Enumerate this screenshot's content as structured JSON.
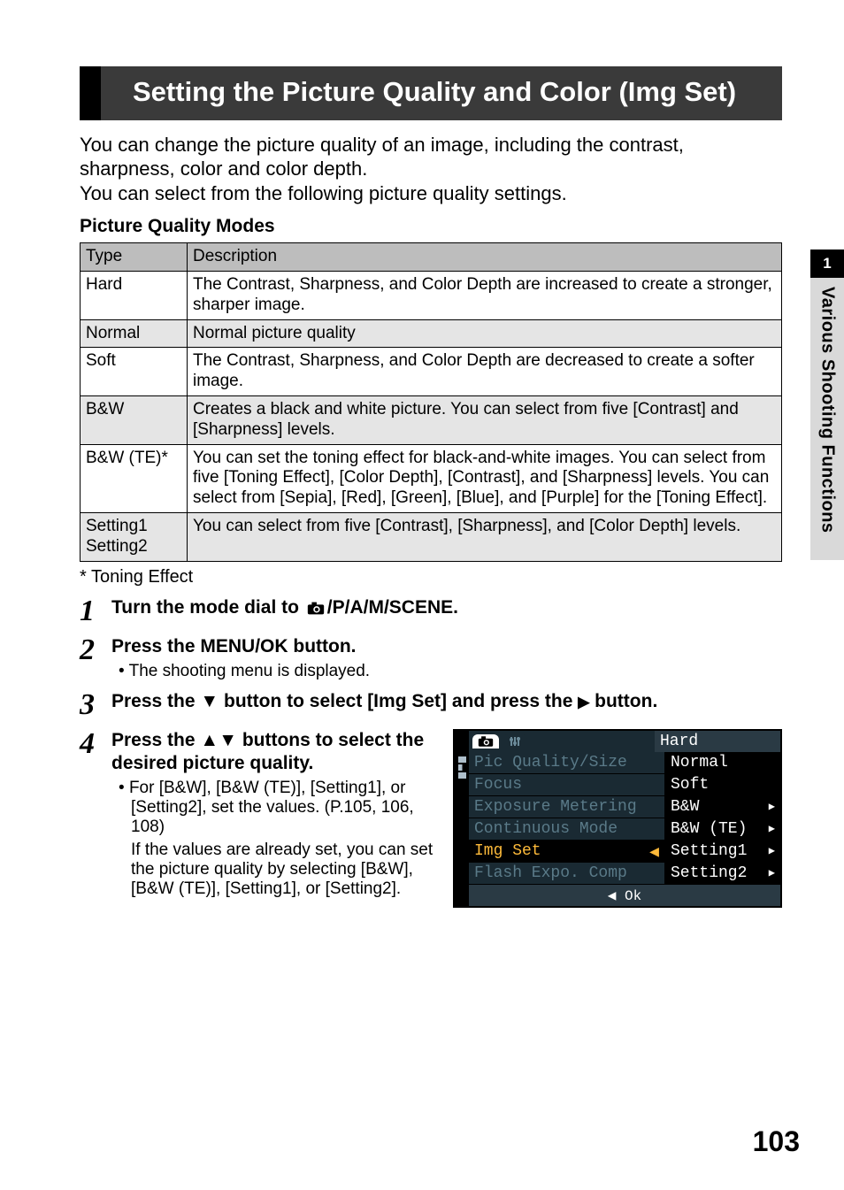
{
  "page": {
    "title": "Setting the Picture Quality and Color (Img Set)",
    "intro": "You can change the picture quality of an image, including the contrast, sharpness, color and color depth.\nYou can select from the following picture quality settings.",
    "subhead": "Picture Quality Modes",
    "table": {
      "header": {
        "c0": "Type",
        "c1": "Description"
      },
      "rows": [
        {
          "type": "Hard",
          "desc": "The Contrast, Sharpness, and Color Depth are increased to create a stronger, sharper image."
        },
        {
          "type": "Normal",
          "desc": "Normal picture quality"
        },
        {
          "type": "Soft",
          "desc": "The Contrast, Sharpness, and Color Depth are decreased to create a softer image."
        },
        {
          "type": "B&W",
          "desc": "Creates a black and white picture. You can select from five [Contrast] and [Sharpness] levels."
        },
        {
          "type": "B&W (TE)*",
          "desc": "You can set the toning effect for black-and-white images. You can select from five [Toning Effect], [Color Depth], [Contrast], and [Sharpness] levels. You can select from [Sepia], [Red], [Green], [Blue], and [Purple] for the [Toning Effect]."
        },
        {
          "type": "Setting1\nSetting2",
          "desc": "You can select from five [Contrast], [Sharpness], and [Color Depth] levels."
        }
      ]
    },
    "footnote": "* Toning Effect",
    "steps": [
      {
        "num": "1",
        "title_before": "Turn the mode dial to ",
        "title_after": "/P/A/M/SCENE."
      },
      {
        "num": "2",
        "title": "Press the MENU/OK button.",
        "sub": "The shooting menu is displayed."
      },
      {
        "num": "3",
        "title_before": "Press the ",
        "title_mid": " button to select [Img Set] and press the ",
        "title_after": " button."
      },
      {
        "num": "4",
        "title_before": "Press the ",
        "title_after": " buttons to select the desired picture quality.",
        "sub1_before": "For [B&W], [B&W (TE)], [Setting1], or [Setting2], set the values. (",
        "sub1_after": "P.105, 106, 108)",
        "sub2": "If the values are already set, you can set the picture quality by selecting [B&W], [B&W (TE)], [Setting1], or [Setting2]."
      }
    ],
    "side": {
      "num": "1",
      "label": "Various Shooting Functions"
    },
    "page_number": "103"
  },
  "lcd": {
    "right_header": "Hard",
    "left_items": [
      "Pic Quality/Size",
      "Focus",
      "Exposure Metering",
      "Continuous Mode",
      "Img Set",
      "Flash Expo. Comp"
    ],
    "left_selected_index": 4,
    "right_items": [
      {
        "label": "Normal",
        "arrow": false
      },
      {
        "label": "Soft",
        "arrow": false
      },
      {
        "label": "B&W",
        "arrow": true
      },
      {
        "label": "B&W (TE)",
        "arrow": true
      },
      {
        "label": "Setting1",
        "arrow": true
      },
      {
        "label": "Setting2",
        "arrow": true
      }
    ],
    "bottom": "◀ Ok"
  }
}
